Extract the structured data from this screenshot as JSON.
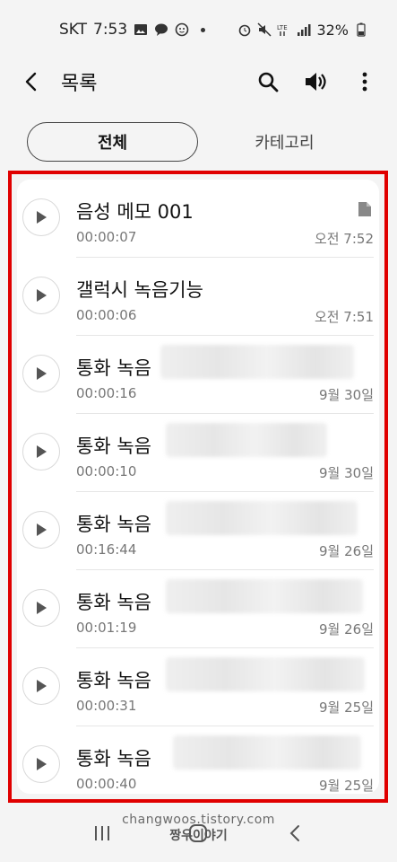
{
  "status_bar": {
    "carrier": "SKT",
    "time": "7:53",
    "battery": "32%",
    "signal_label": "LTE"
  },
  "app_bar": {
    "title": "목록",
    "icons": [
      "back-icon",
      "search-icon",
      "speaker-icon",
      "more-icon"
    ]
  },
  "tabs": [
    {
      "label": "전체",
      "selected": true
    },
    {
      "label": "카테고리",
      "selected": false
    }
  ],
  "recordings": [
    {
      "name": "음성 메모 001",
      "duration": "00:00:07",
      "date": "오전 7:52",
      "has_file_icon": true
    },
    {
      "name": "갤럭시 녹음기능",
      "duration": "00:00:06",
      "date": "오전 7:51",
      "has_file_icon": false
    },
    {
      "name": "통화 녹음",
      "duration": "00:00:16",
      "date": "9월 30일",
      "has_file_icon": false
    },
    {
      "name": "통화 녹음",
      "duration": "00:00:10",
      "date": "9월 30일",
      "has_file_icon": false
    },
    {
      "name": "통화 녹음",
      "duration": "00:16:44",
      "date": "9월 26일",
      "has_file_icon": false
    },
    {
      "name": "통화 녹음",
      "duration": "00:01:19",
      "date": "9월 26일",
      "has_file_icon": false
    },
    {
      "name": "통화 녹음",
      "duration": "00:00:31",
      "date": "9월 25일",
      "has_file_icon": false
    },
    {
      "name": "통화 녹음",
      "duration": "00:00:40",
      "date": "9월 25일",
      "has_file_icon": false
    }
  ],
  "watermark": {
    "line1": "changwoos.tistory.com",
    "line2": "짱우이야기"
  },
  "colors": {
    "highlight_border": "#e00000",
    "background": "#f4f4f4",
    "card": "#ffffff"
  }
}
